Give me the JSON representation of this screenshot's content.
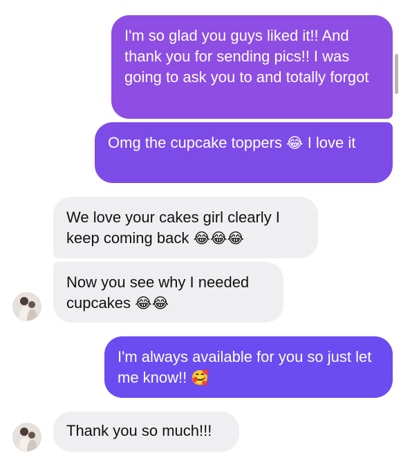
{
  "messages": [
    {
      "sender": "me",
      "text": "I'm so glad you guys liked it!! And thank you for sending pics!! I was going to ask you to and totally forgot",
      "color": "#8e4de3"
    },
    {
      "sender": "me",
      "text_before": "Omg the cupcake toppers ",
      "emoji": "😂",
      "text_after": " I love it",
      "color": "#7d4be8"
    },
    {
      "sender": "them",
      "text_before": "We love your cakes girl clearly I keep coming back ",
      "emoji": "😂😂😂"
    },
    {
      "sender": "them",
      "text_before": "Now you see why I needed cupcakes ",
      "emoji": "😂😂",
      "has_avatar": true
    },
    {
      "sender": "me",
      "text_before": "I'm always available for you so just let me know!! ",
      "emoji": "🥰",
      "color": "#6a4cf0"
    },
    {
      "sender": "them",
      "text": "Thank you so much!!!",
      "has_avatar": true
    }
  ],
  "colors": {
    "incoming_bubble": "#efeff1",
    "gradient_top": "#9a4ddf",
    "gradient_bottom": "#634ef2"
  },
  "icons": [
    "avatar-photo",
    "scrollbar"
  ]
}
